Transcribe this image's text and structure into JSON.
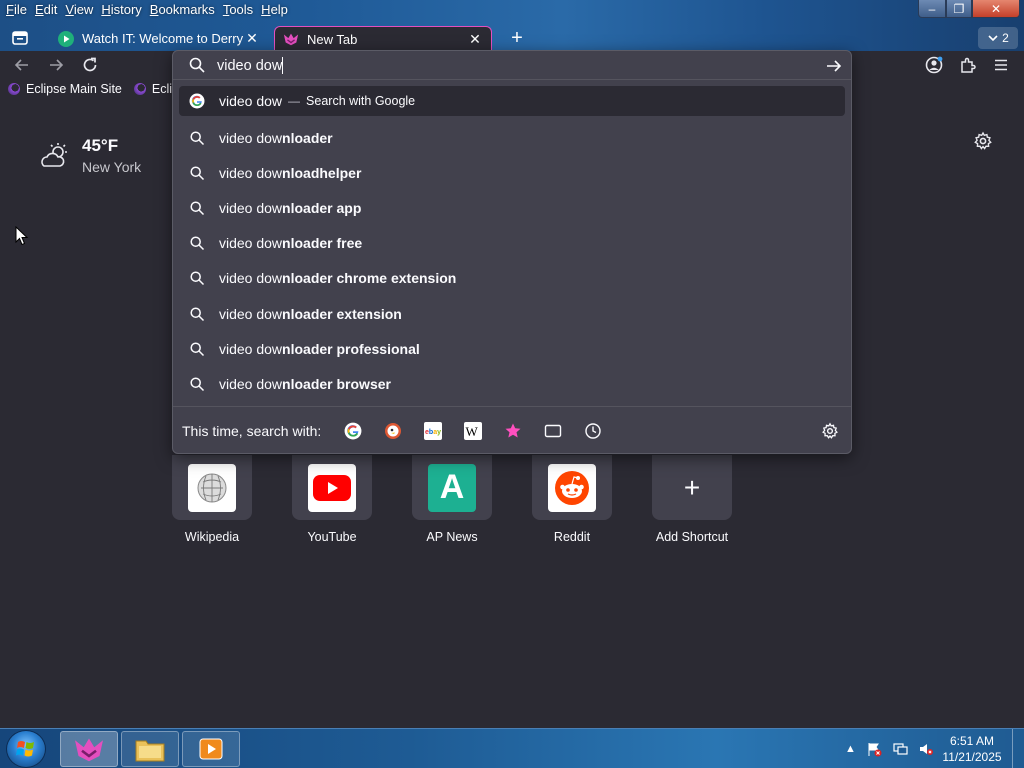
{
  "menubar": {
    "items": [
      {
        "label": "File",
        "u": "F",
        "rest": "ile"
      },
      {
        "label": "Edit",
        "u": "E",
        "rest": "dit"
      },
      {
        "label": "View",
        "u": "V",
        "rest": "iew"
      },
      {
        "label": "History",
        "u": "H",
        "rest": "istory"
      },
      {
        "label": "Bookmarks",
        "u": "B",
        "rest": "ookmarks"
      },
      {
        "label": "Tools",
        "u": "T",
        "rest": "ools"
      },
      {
        "label": "Help",
        "u": "H",
        "rest": "elp"
      }
    ]
  },
  "window_controls": {
    "minimize": "–",
    "maximize": "❐",
    "close": "✕"
  },
  "tabs": [
    {
      "title": "Watch IT: Welcome to Derry - Se",
      "close": "✕"
    },
    {
      "title": "New Tab",
      "close": "✕"
    }
  ],
  "new_tab_glyph": "+",
  "tab_count": "2",
  "bookmarks": [
    "Eclipse Main Site",
    "Eclips"
  ],
  "weather": {
    "temp": "45°F",
    "city": "New York"
  },
  "urlbar": {
    "value": "video dow",
    "selected_suggestion": {
      "query": "video dow",
      "separator": "—",
      "action": "Search with Google"
    },
    "suggestions": [
      {
        "typed": "video dow",
        "completion": "nloader"
      },
      {
        "typed": "video dow",
        "completion": "nloadhelper"
      },
      {
        "typed": "video dow",
        "completion": "nloader app"
      },
      {
        "typed": "video dow",
        "completion": "nloader free"
      },
      {
        "typed": "video dow",
        "completion": "nloader chrome extension"
      },
      {
        "typed": "video dow",
        "completion": "nloader extension"
      },
      {
        "typed": "video dow",
        "completion": "nloader professional"
      },
      {
        "typed": "video dow",
        "completion": "nloader browser"
      }
    ],
    "search_with_label": "This time, search with:",
    "engines": [
      "google-icon",
      "duckduckgo-icon",
      "ebay-icon",
      "wikipedia-icon",
      "bookmarks-star-icon",
      "tabs-icon",
      "history-icon"
    ]
  },
  "shortcuts": [
    {
      "label": "Wikipedia"
    },
    {
      "label": "YouTube"
    },
    {
      "label": "AP News",
      "logo_letter": "A"
    },
    {
      "label": "Reddit"
    },
    {
      "label": "Add Shortcut",
      "glyph": "+"
    }
  ],
  "taskbar": {
    "time": "6:51 AM",
    "date": "11/21/2025"
  },
  "colors": {
    "page_bg": "#2b2a33",
    "popup_bg": "#42414d",
    "accent_pink": "#e44fbf",
    "titlebar_blue": "#1f5a97"
  }
}
